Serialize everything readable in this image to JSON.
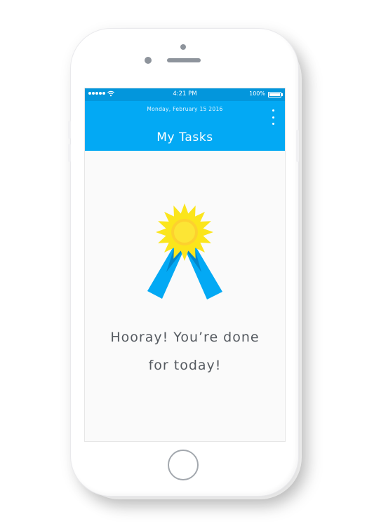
{
  "status_bar": {
    "time": "4:21 PM",
    "battery": "100%"
  },
  "header": {
    "date": "Monday, February 15 2016",
    "title": "My Tasks",
    "menu_icon": "more-vertical-icon"
  },
  "empty_state": {
    "icon": "award-ribbon-icon",
    "line1": "Hooray! You’re done",
    "line2": "for today!"
  },
  "colors": {
    "accent": "#03a9f4",
    "status_bar": "#0396dc",
    "medal": "#fbe51c",
    "medal_center": "#fdd12e",
    "text": "#555a60"
  }
}
